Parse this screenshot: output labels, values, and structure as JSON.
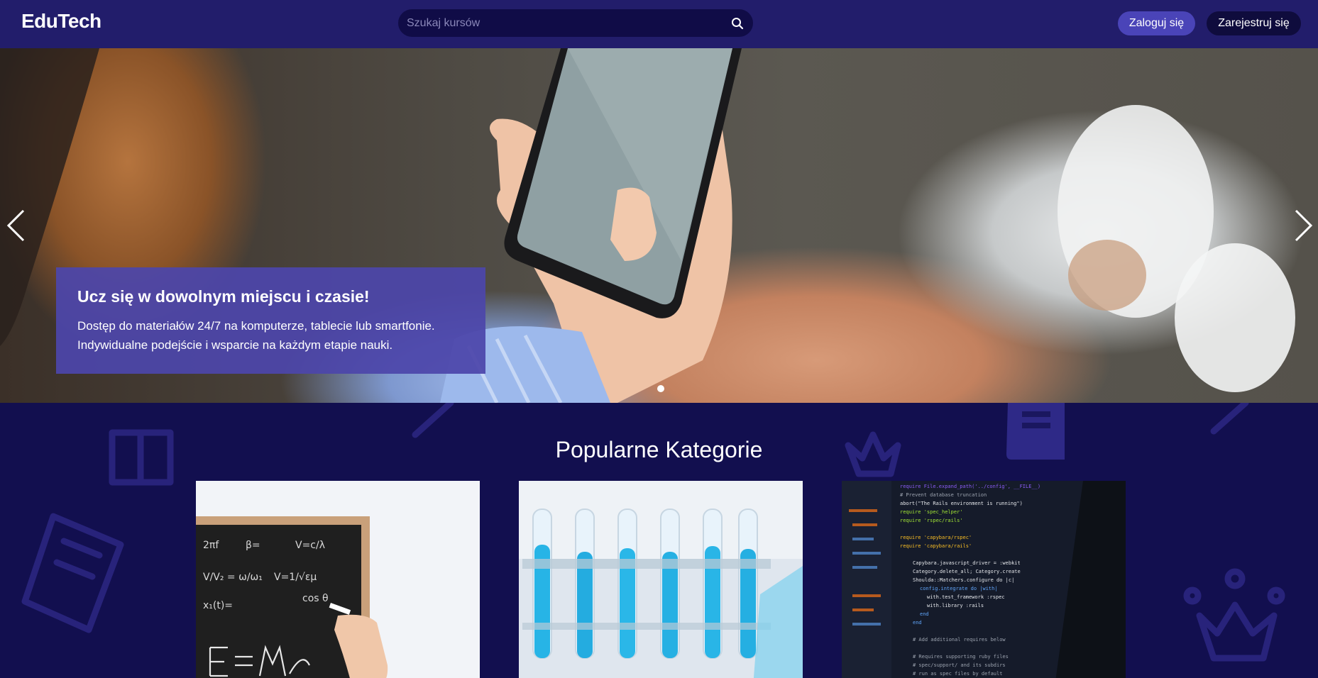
{
  "header": {
    "logo": "EduTech",
    "search_placeholder": "Szukaj kursów",
    "login_label": "Zaloguj się",
    "register_label": "Zarejestruj się"
  },
  "hero": {
    "title": "Ucz się w dowolnym miejscu i czasie!",
    "line1": "Dostęp do materiałów 24/7 na komputerze, tablecie lub smartfonie.",
    "line2": "Indywidualne podejście i wsparcie na każdym etapie nauki.",
    "slide_count": 1,
    "active_slide": 1
  },
  "categories": {
    "title": "Popularne Kategorie",
    "cards": [
      {
        "image": "physics-blackboard"
      },
      {
        "image": "chemistry-test-tubes"
      },
      {
        "image": "programming-code"
      }
    ]
  },
  "colors": {
    "header_bg": "#221d6b",
    "page_bg": "#120f4f",
    "accent": "#4a44b8",
    "hero_card_bg": "#4c46aa"
  },
  "icons": {
    "search": "search-icon",
    "prev": "chevron-left-icon",
    "next": "chevron-right-icon"
  }
}
